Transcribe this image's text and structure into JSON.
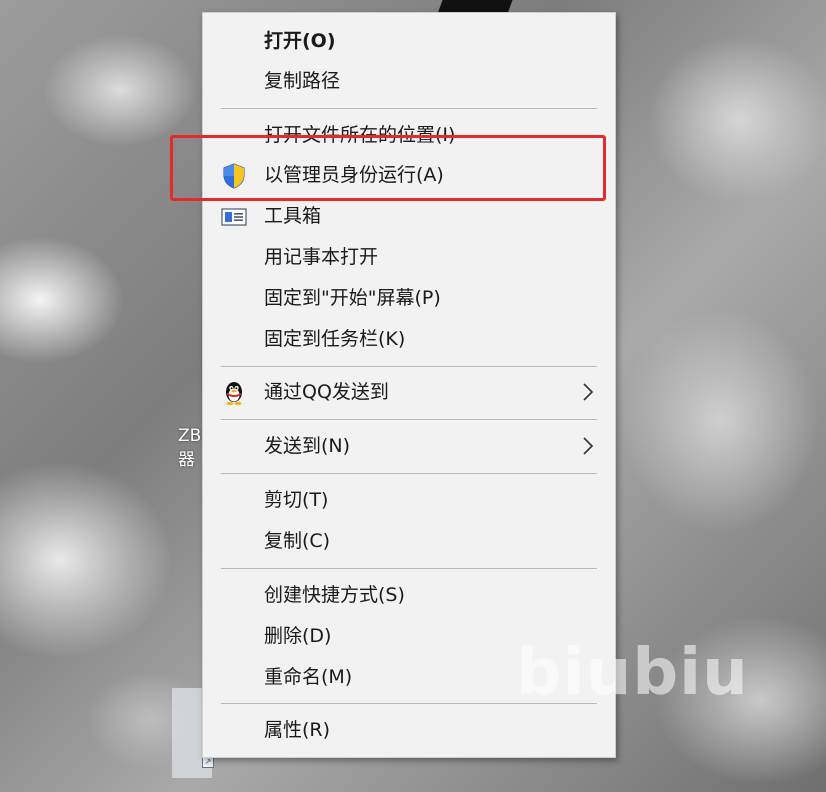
{
  "desktop": {
    "icon_label": "ZB\n器",
    "watermark": "biubiu"
  },
  "menu": {
    "items": [
      {
        "label": "打开(O)",
        "icon": "",
        "bold": true
      },
      {
        "label": "复制路径",
        "icon": ""
      },
      {
        "label": "打开文件所在的位置(I)",
        "icon": ""
      },
      {
        "label": "以管理员身份运行(A)",
        "icon": "uac-shield-icon",
        "highlighted": true
      },
      {
        "label": "工具箱",
        "icon": "toolbox-icon"
      },
      {
        "label": "用记事本打开",
        "icon": ""
      },
      {
        "label": "固定到\"开始\"屏幕(P)",
        "icon": ""
      },
      {
        "label": "固定到任务栏(K)",
        "icon": ""
      },
      {
        "label": "通过QQ发送到",
        "icon": "qq-penguin-icon",
        "submenu": true
      },
      {
        "label": "发送到(N)",
        "icon": "",
        "submenu": true
      },
      {
        "label": "剪切(T)",
        "icon": ""
      },
      {
        "label": "复制(C)",
        "icon": ""
      },
      {
        "label": "创建快捷方式(S)",
        "icon": ""
      },
      {
        "label": "删除(D)",
        "icon": ""
      },
      {
        "label": "重命名(M)",
        "icon": ""
      },
      {
        "label": "属性(R)",
        "icon": ""
      }
    ]
  },
  "colors": {
    "menu_background": "#f2f2f2",
    "separator": "#b9b9b9",
    "highlight_border": "#e52a2a",
    "shield_blue": "#2f6fd6",
    "shield_yellow": "#f3c623"
  }
}
